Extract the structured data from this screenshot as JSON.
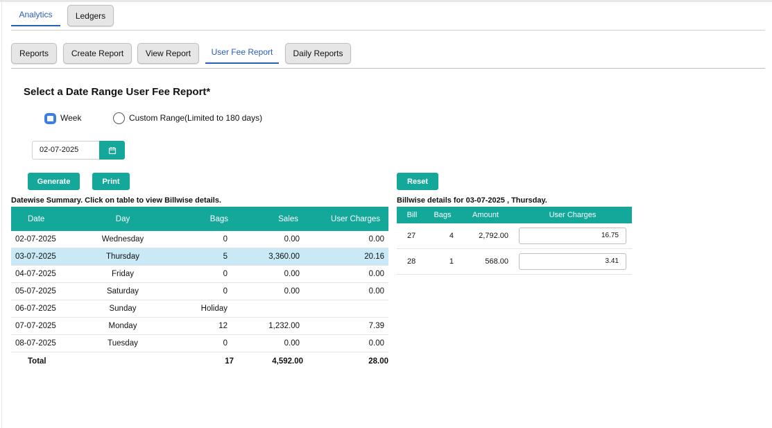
{
  "top_tabs": [
    {
      "label": "Analytics",
      "active": true
    },
    {
      "label": "Ledgers",
      "active": false
    }
  ],
  "report_tabs": [
    {
      "label": "Reports",
      "active": false
    },
    {
      "label": "Create Report",
      "active": false
    },
    {
      "label": "View Report",
      "active": false
    },
    {
      "label": "User Fee Report",
      "active": true
    },
    {
      "label": "Daily Reports",
      "active": false
    }
  ],
  "form": {
    "title": "Select a Date Range User Fee Report*",
    "radio_week_label": "Week",
    "radio_custom_label": "Custom Range(Limited to 180 days)",
    "selected": "Week",
    "date_value": "02-07-2025",
    "generate_label": "Generate",
    "print_label": "Print",
    "reset_label": "Reset"
  },
  "summary": {
    "caption": "Datewise Summary. Click on table to view Billwise details.",
    "headers": [
      "Date",
      "Day",
      "Bags",
      "Sales",
      "User Charges"
    ],
    "rows": [
      {
        "date": "02-07-2025",
        "day": "Wednesday",
        "bags": "0",
        "sales": "0.00",
        "charges": "0.00"
      },
      {
        "date": "03-07-2025",
        "day": "Thursday",
        "bags": "5",
        "sales": "3,360.00",
        "charges": "20.16"
      },
      {
        "date": "04-07-2025",
        "day": "Friday",
        "bags": "0",
        "sales": "0.00",
        "charges": "0.00"
      },
      {
        "date": "05-07-2025",
        "day": "Saturday",
        "bags": "0",
        "sales": "0.00",
        "charges": "0.00"
      },
      {
        "date": "06-07-2025",
        "day": "Sunday",
        "bags": "Holiday",
        "sales": "",
        "charges": ""
      },
      {
        "date": "07-07-2025",
        "day": "Monday",
        "bags": "12",
        "sales": "1,232.00",
        "charges": "7.39"
      },
      {
        "date": "08-07-2025",
        "day": "Tuesday",
        "bags": "0",
        "sales": "0.00",
        "charges": "0.00"
      }
    ],
    "highlighted_row": 1,
    "total": {
      "label": "Total",
      "bags": "17",
      "sales": "4,592.00",
      "charges": "28.00"
    }
  },
  "billwise": {
    "caption": "Billwise details for 03-07-2025 , Thursday.",
    "headers": [
      "Bill",
      "Bags",
      "Amount",
      "User Charges"
    ],
    "rows": [
      {
        "bill": "27",
        "bags": "4",
        "amount": "2,792.00",
        "charges": "16.75"
      },
      {
        "bill": "28",
        "bags": "1",
        "amount": "568.00",
        "charges": "3.41"
      }
    ]
  },
  "colors": {
    "accent": "#14a89a",
    "link": "#2a5bbd",
    "highlight_row": "#c9e9f7"
  }
}
